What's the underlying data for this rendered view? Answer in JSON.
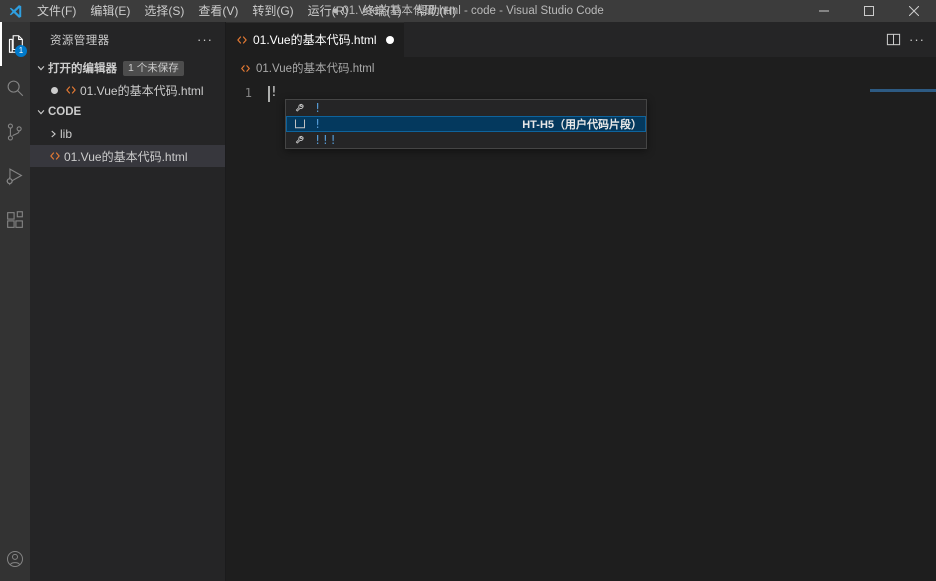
{
  "titlebar": {
    "window_title": "● 01.Vue的基本代码.html - code - Visual Studio Code",
    "menu": [
      {
        "label": "文件(F)",
        "name": "menu-file"
      },
      {
        "label": "编辑(E)",
        "name": "menu-edit"
      },
      {
        "label": "选择(S)",
        "name": "menu-selection"
      },
      {
        "label": "查看(V)",
        "name": "menu-view"
      },
      {
        "label": "转到(G)",
        "name": "menu-go"
      },
      {
        "label": "运行(R)",
        "name": "menu-run"
      },
      {
        "label": "终端(T)",
        "name": "menu-terminal"
      },
      {
        "label": "帮助(H)",
        "name": "menu-help"
      }
    ],
    "controls": {
      "minimize": "─",
      "maximize": "□",
      "close": "✕"
    }
  },
  "activitybar": {
    "items": [
      {
        "icon": "explorer-icon",
        "badge": "1",
        "active": true
      },
      {
        "icon": "search-icon",
        "badge": "",
        "active": false
      },
      {
        "icon": "source-control-icon",
        "badge": "",
        "active": false
      },
      {
        "icon": "run-debug-icon",
        "badge": "",
        "active": false
      },
      {
        "icon": "extensions-icon",
        "badge": "",
        "active": false
      }
    ],
    "account_icon": "account-icon"
  },
  "sidebar": {
    "title": "资源管理器",
    "more_actions": "···",
    "open_editors": {
      "label": "打开的编辑器",
      "badge": "1 个未保存",
      "items": [
        {
          "label": "01.Vue的基本代码.html",
          "dirty": true,
          "icon": "html-file-icon"
        }
      ]
    },
    "folder": {
      "label": "CODE",
      "items": [
        {
          "label": "lib",
          "type": "folder",
          "icon": "chevron-right-icon"
        },
        {
          "label": "01.Vue的基本代码.html",
          "type": "file",
          "icon": "html-file-icon",
          "selected": true
        }
      ]
    }
  },
  "editor": {
    "tab": {
      "label": "01.Vue的基本代码.html",
      "icon": "html-file-icon",
      "dirty": true
    },
    "actions": {
      "split_editor": "split-editor-icon",
      "more": "···"
    },
    "breadcrumb": {
      "icon": "html-file-icon",
      "label": "01.Vue的基本代码.html"
    },
    "lines": [
      {
        "number": "1",
        "text": "!"
      }
    ]
  },
  "suggest_widget": {
    "rows": [
      {
        "icon": "snippet-wrench-icon",
        "label": "!",
        "detail": "",
        "selected": false
      },
      {
        "icon": "snippet-box-icon",
        "label": "!",
        "detail": "HT-H5（用户代码片段）",
        "selected": true
      },
      {
        "icon": "snippet-wrench-icon",
        "label": "!!!",
        "detail": "",
        "selected": false
      }
    ]
  },
  "colors": {
    "accent": "#007acc",
    "selection": "#04395e",
    "html_icon": "#e37933",
    "keyword_blue": "#569cd6"
  }
}
